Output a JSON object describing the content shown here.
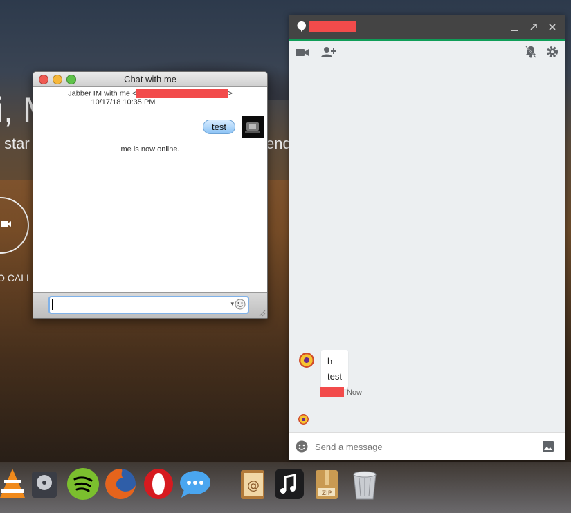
{
  "background": {
    "greeting_fragment": "i, M",
    "subtitle_left": "star",
    "subtitle_right": "end",
    "call_label": "O CALL"
  },
  "mac_chat": {
    "title": "Chat with me",
    "header_prefix": "Jabber IM with me <",
    "header_suffix": ">",
    "timestamp": "10/17/18 10:35 PM",
    "sent_message": "test",
    "status": "me is now online.",
    "input_value": ""
  },
  "hangouts": {
    "messages": [
      "h",
      "test"
    ],
    "time": "Now",
    "input_placeholder": "Send a message",
    "accent": "#0f9d58"
  },
  "dock": {
    "apps": [
      "vlc-icon",
      "disk-utility-icon",
      "spotify-icon",
      "firefox-icon",
      "opera-icon",
      "messages-icon",
      "contacts-icon",
      "itunes-icon",
      "archive-utility-icon",
      "trash-icon"
    ]
  }
}
